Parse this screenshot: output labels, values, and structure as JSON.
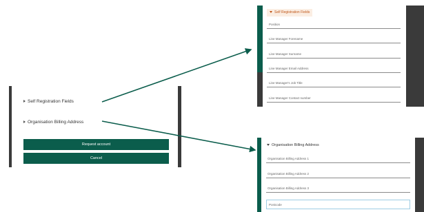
{
  "form": {
    "sections": {
      "self_registration": "Self Registration Fields",
      "billing_address": "Organisation Billing Address"
    },
    "buttons": {
      "request_account": "Request account",
      "cancel": "Cancel"
    }
  },
  "zoom_self_registration": {
    "header": "Self Registration Fields",
    "fields": [
      "Position",
      "Line Manager Forename",
      "Line Manager Surname",
      "Line Manager Email Address",
      "Line Manager's Job Title",
      "Line Manager Contact number"
    ]
  },
  "zoom_billing_address": {
    "header": "Organisation Billing Address",
    "fields": [
      "Organisation Billing Address 1",
      "Organisation Billing Address 2",
      "Organisation Billing Address 3",
      "Postcode"
    ]
  },
  "colors": {
    "primary": "#0b5d4c",
    "dark_bar": "#3a3a3a",
    "arrow": "#0b5d4c",
    "highlight_bg": "#fbeee3",
    "highlight_text": "#c0571a"
  }
}
